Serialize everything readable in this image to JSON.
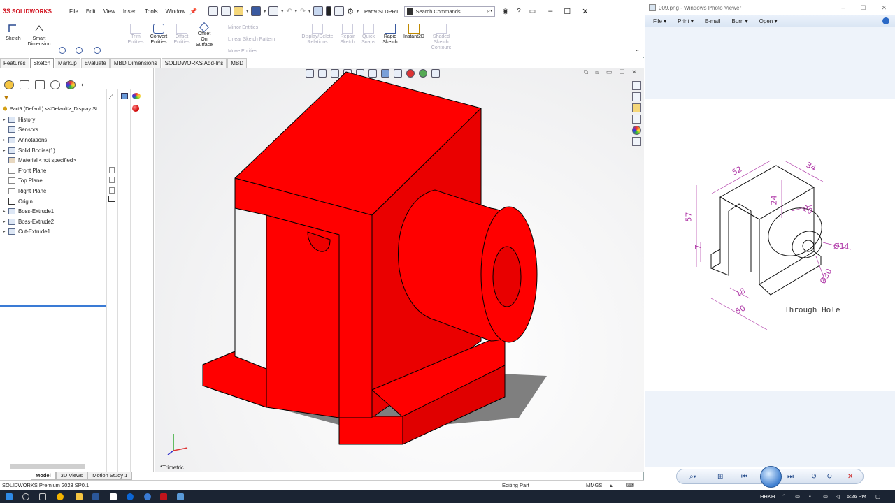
{
  "solidworks": {
    "brand": "SOLIDWORKS",
    "menu": [
      "File",
      "Edit",
      "View",
      "Insert",
      "Tools",
      "Window"
    ],
    "document_name": "Part9.SLDPRT",
    "search_placeholder": "Search Commands",
    "ribbon": {
      "sketch": "Sketch",
      "smart_dimension": "Smart Dimension",
      "trim_entities": "Trim Entities",
      "convert_entities": "Convert Entities",
      "offset_entities": "Offset Entities",
      "offset_on_surface": "Offset On Surface",
      "mirror_entities": "Mirror Entities",
      "linear_sketch_pattern": "Linear Sketch Pattern",
      "move_entities": "Move Entities",
      "display_delete_relations": "Display/Delete Relations",
      "repair_sketch": "Repair Sketch",
      "quick_snaps": "Quick Snaps",
      "rapid_sketch": "Rapid Sketch",
      "instant2d": "Instant2D",
      "shaded_sketch_contours": "Shaded Sketch Contours"
    },
    "tabs": [
      "Features",
      "Sketch",
      "Markup",
      "Evaluate",
      "MBD Dimensions",
      "SOLIDWORKS Add-Ins",
      "MBD"
    ],
    "active_tab": "Sketch",
    "feature_tree": {
      "root": "Part9 (Default) <<Default>_Display St",
      "items": [
        {
          "label": "History",
          "expandable": true
        },
        {
          "label": "Sensors",
          "expandable": false
        },
        {
          "label": "Annotations",
          "expandable": true
        },
        {
          "label": "Solid Bodies(1)",
          "expandable": true
        },
        {
          "label": "Material <not specified>",
          "expandable": false
        },
        {
          "label": "Front Plane",
          "expandable": false
        },
        {
          "label": "Top Plane",
          "expandable": false
        },
        {
          "label": "Right Plane",
          "expandable": false
        },
        {
          "label": "Origin",
          "expandable": false
        },
        {
          "label": "Boss-Extrude1",
          "expandable": true
        },
        {
          "label": "Boss-Extrude2",
          "expandable": true
        },
        {
          "label": "Cut-Extrude1",
          "expandable": true
        }
      ]
    },
    "bottom_tabs": [
      "Model",
      "3D Views",
      "Motion Study 1"
    ],
    "active_bottom_tab": "Model",
    "view_label": "*Trimetric",
    "status": {
      "product": "SOLIDWORKS Premium 2023 SP0.1",
      "mode": "Editing Part",
      "units": "MMGS"
    },
    "part_color": "#ff0000"
  },
  "photo_viewer": {
    "title": "009.png - Windows Photo Viewer",
    "menu": [
      "File",
      "Print",
      "E-mail",
      "Burn",
      "Open"
    ],
    "drawing": {
      "dims": [
        "52",
        "34",
        "57",
        "24",
        "20",
        "7",
        "Ø14",
        "Ø30",
        "18",
        "50"
      ],
      "note": "Through Hole"
    }
  },
  "taskbar": {
    "lang": "HHKH",
    "time": "5:26 PM"
  }
}
